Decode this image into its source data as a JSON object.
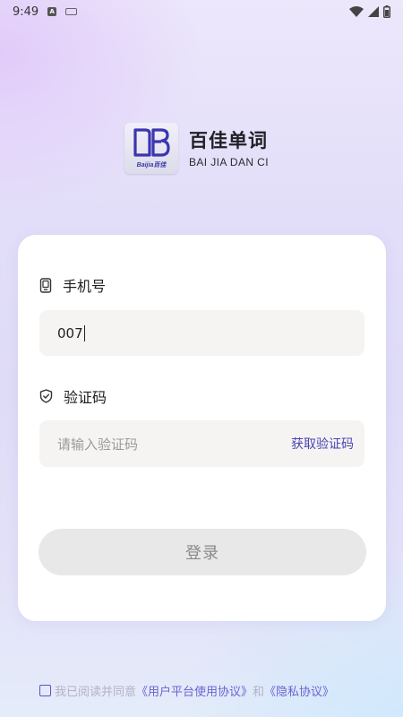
{
  "status_bar": {
    "time": "9:49",
    "notif_icon_letter": "A"
  },
  "logo": {
    "badge_text": "Baijia百佳",
    "title_cn": "百佳单词",
    "title_en": "BAI JIA DAN CI"
  },
  "form": {
    "phone": {
      "label": "手机号",
      "icon": "phone-icon",
      "value": "007"
    },
    "code": {
      "label": "验证码",
      "icon": "shield-check-icon",
      "placeholder": "请输入验证码",
      "get_code_label": "获取验证码"
    },
    "login_label": "登录"
  },
  "agreement": {
    "checked": false,
    "prefix": "我已阅读并同意",
    "user_agreement": "《用户平台使用协议》",
    "and": "和",
    "privacy": "《隐私协议》"
  },
  "colors": {
    "accent": "#4a43b0",
    "card": "#ffffff",
    "input_bg": "#f5f4f3",
    "button_disabled": "#e8e8e8"
  }
}
